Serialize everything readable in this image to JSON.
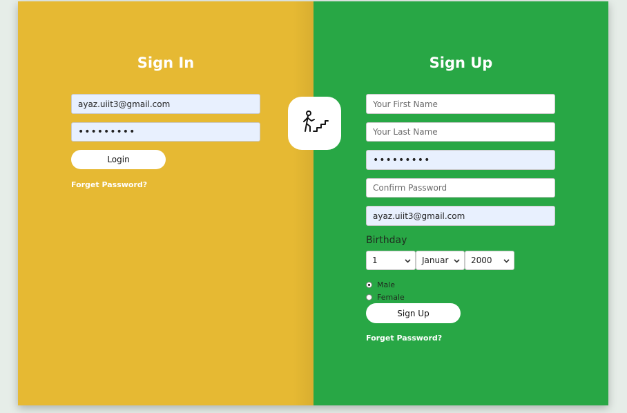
{
  "signin": {
    "title": "Sign In",
    "email_value": "ayaz.uiit3@gmail.com",
    "password_value": "123456789",
    "login_label": "Login",
    "forget_label": "Forget Password?"
  },
  "signup": {
    "title": "Sign Up",
    "first_name_placeholder": "Your First Name",
    "last_name_placeholder": "Your Last Name",
    "password_value": "123456789",
    "confirm_placeholder": "Confirm Password",
    "email_value": "ayaz.uiit3@gmail.com",
    "birthday_label": "Birthday",
    "day_value": "1",
    "month_value": "Januar",
    "year_value": "2000",
    "gender_male": "Male",
    "gender_female": "Female",
    "submit_label": "Sign Up",
    "forget_label": "Forget Password?"
  },
  "icons": {
    "center": "person-climbing-stairs-icon",
    "select_arrow": "chevron-down-icon"
  },
  "colors": {
    "signin_bg": "#e6b933",
    "signup_bg": "#28a745",
    "page_bg": "#e6ede8"
  }
}
